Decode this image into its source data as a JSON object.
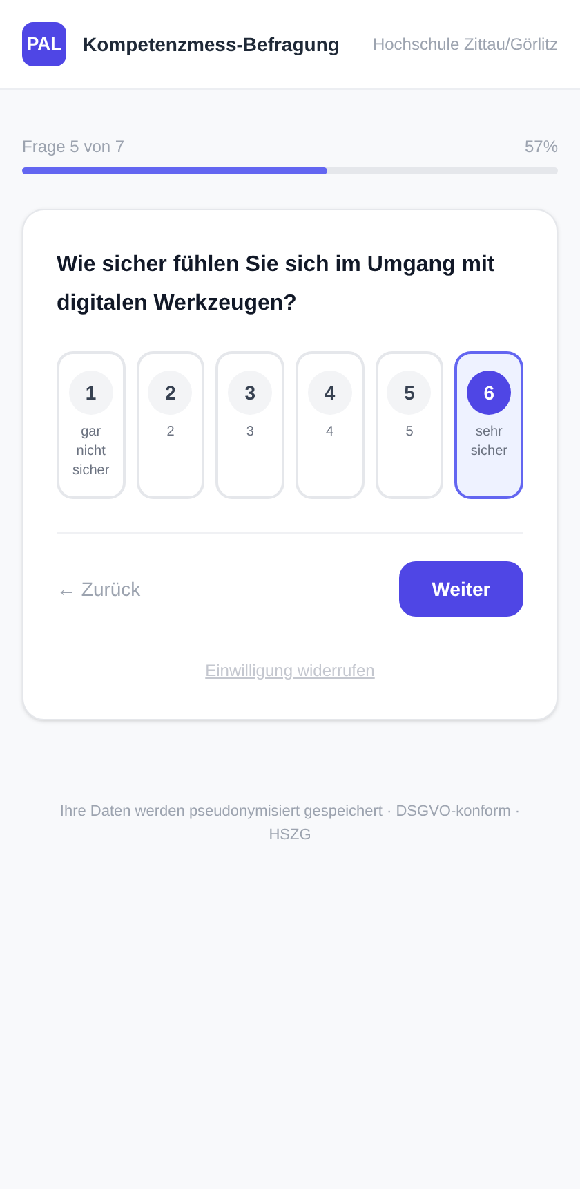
{
  "header": {
    "logo": "PAL",
    "title": "Kompetenzmess-Befragung",
    "institution": "Hochschule Zittau/Görlitz"
  },
  "progress": {
    "label": "Frage 5 von 7",
    "percent": "57%",
    "level": 0.57
  },
  "question": {
    "text": "Wie sicher fühlen Sie sich im Umgang mit digitalen Werkzeugen?",
    "options": [
      {
        "number": "1",
        "label": "gar nicht sicher",
        "selected": false
      },
      {
        "number": "2",
        "label": "2",
        "selected": false
      },
      {
        "number": "3",
        "label": "3",
        "selected": false
      },
      {
        "number": "4",
        "label": "4",
        "selected": false
      },
      {
        "number": "5",
        "label": "5",
        "selected": false
      },
      {
        "number": "6",
        "label": "sehr sicher",
        "selected": true
      }
    ]
  },
  "navigation": {
    "back": "← Zurück",
    "next": "Weiter"
  },
  "withdraw_link": "Einwilligung widerrufen",
  "footer": "Ihre Daten werden pseudonymisiert gespeichert · DSGVO-konform · HSZG"
}
